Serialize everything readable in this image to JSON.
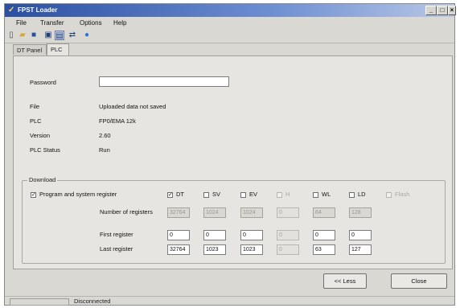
{
  "window": {
    "title": "FPST Loader",
    "controls": {
      "minimize": "_",
      "maximize": "□",
      "close": "×"
    }
  },
  "menu": [
    "File",
    "Transfer",
    "Options",
    "Help"
  ],
  "toolbar": [
    "new-icon",
    "open-icon",
    "save-icon",
    "print-icon",
    "monitor-icon",
    "transfer-icon",
    "help-icon"
  ],
  "tabs": [
    {
      "label": "DT Panel",
      "active": false
    },
    {
      "label": "PLC",
      "active": true
    }
  ],
  "plc": {
    "password_label": "Password",
    "password_value": "",
    "file_label": "File",
    "file_value": "Uploaded data not saved",
    "plc_label": "PLC",
    "plc_value": "FP0/EMA 12k",
    "version_label": "Version",
    "version_value": "2.60",
    "status_label": "PLC Status",
    "status_value": "Run"
  },
  "download": {
    "title": "Download",
    "program_label": "Program and system register",
    "program_checked": true,
    "registers": [
      {
        "label": "DT",
        "checked": true,
        "enabled": true,
        "count": "32764",
        "first": "0",
        "last": "32764"
      },
      {
        "label": "SV",
        "checked": false,
        "enabled": true,
        "count": "1024",
        "first": "0",
        "last": "1023"
      },
      {
        "label": "EV",
        "checked": false,
        "enabled": true,
        "count": "1024",
        "first": "0",
        "last": "1023"
      },
      {
        "label": "H",
        "checked": false,
        "enabled": false,
        "count": "0",
        "first": "0",
        "last": "0"
      },
      {
        "label": "WL",
        "checked": false,
        "enabled": true,
        "count": "64",
        "first": "0",
        "last": "63"
      },
      {
        "label": "LD",
        "checked": false,
        "enabled": true,
        "count": "128",
        "first": "0",
        "last": "127"
      },
      {
        "label": "Flash",
        "checked": false,
        "enabled": false
      }
    ],
    "count_label": "Number of registers",
    "first_label": "First register",
    "last_label": "Last register"
  },
  "buttons": {
    "back": "<< Less",
    "close": "Close"
  },
  "status": {
    "connection": "Disconnected"
  }
}
